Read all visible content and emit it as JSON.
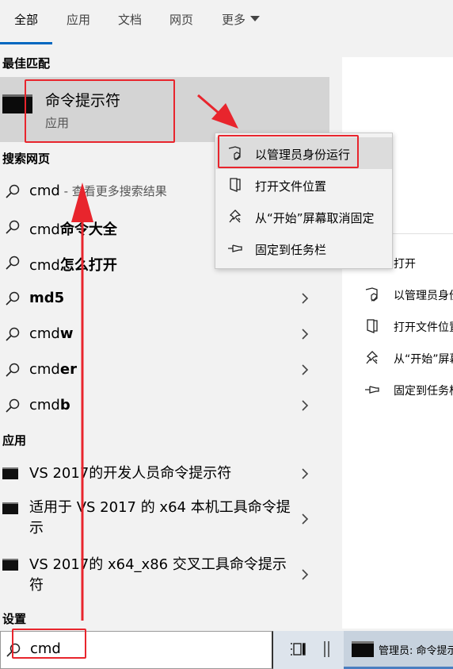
{
  "tabs": [
    "全部",
    "应用",
    "文档",
    "网页",
    "更多"
  ],
  "best_match": {
    "heading": "最佳匹配",
    "title": "命令提示符",
    "subtitle": "应用"
  },
  "web": {
    "heading": "搜索网页",
    "first": {
      "query": "cmd",
      "suffix": " - 查看更多搜索结果"
    },
    "suggestions": [
      {
        "prefix": "cmd",
        "bold": "命令大全"
      },
      {
        "prefix": "cmd",
        "bold": "怎么打开"
      },
      {
        "prefix": "",
        "bold": "md5"
      },
      {
        "prefix": "cmd",
        "bold": "w"
      },
      {
        "prefix": "cmd",
        "bold": "er"
      },
      {
        "prefix": "cmd",
        "bold": "b"
      }
    ]
  },
  "apps": {
    "heading": "应用",
    "items": [
      "VS 2017的开发人员命令提示符",
      "适用于 VS 2017 的 x64 本机工具命令提示",
      "VS 2017的 x64_x86 交叉工具命令提示符"
    ]
  },
  "settings": {
    "heading": "设置"
  },
  "context_menu": {
    "items": [
      "以管理员身份运行",
      "打开文件位置",
      "从“开始”屏幕取消固定",
      "固定到任务栏"
    ]
  },
  "right_panel": {
    "items": [
      "打开",
      "以管理员身份运行",
      "打开文件位置",
      "从“开始”屏幕取消固定",
      "固定到任务栏"
    ]
  },
  "search": {
    "value": "cmd"
  },
  "taskbar": {
    "window_title": "管理员: 命令提示符"
  },
  "colors": {
    "accent": "#0067c0",
    "annotation": "#e8252d"
  }
}
